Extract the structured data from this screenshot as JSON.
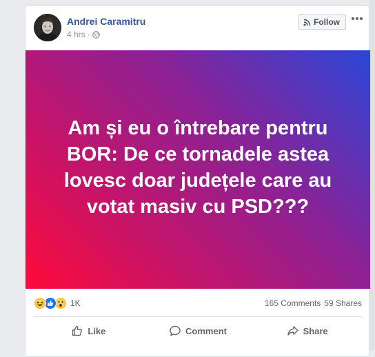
{
  "post": {
    "author": "Andrei Caramitru",
    "time": "4 hrs",
    "separator": "·",
    "privacy_icon": "globe-icon",
    "follow_label": "Follow",
    "follow_icon": "rss-icon",
    "more_icon": "more-dots-icon"
  },
  "hero": {
    "text": "Am și eu o întrebare pentru BOR: De ce tornadele astea lovesc doar județele care au votat masiv cu PSD???",
    "gradient_colors": [
      "#ff0a3a",
      "#c4146a",
      "#8a2296",
      "#2b46d8"
    ]
  },
  "stats": {
    "reactions": [
      "haha-icon",
      "like-icon",
      "wow-icon"
    ],
    "reaction_count": "1K",
    "comments": "165 Comments",
    "shares": "59 Shares"
  },
  "actions": [
    {
      "label": "Like",
      "icon": "thumbs-up-icon"
    },
    {
      "label": "Comment",
      "icon": "comment-bubble-icon"
    },
    {
      "label": "Share",
      "icon": "share-arrow-icon"
    }
  ],
  "colors": {
    "author_link": "#365899",
    "meta_text": "#90949c",
    "action_text": "#606770"
  }
}
